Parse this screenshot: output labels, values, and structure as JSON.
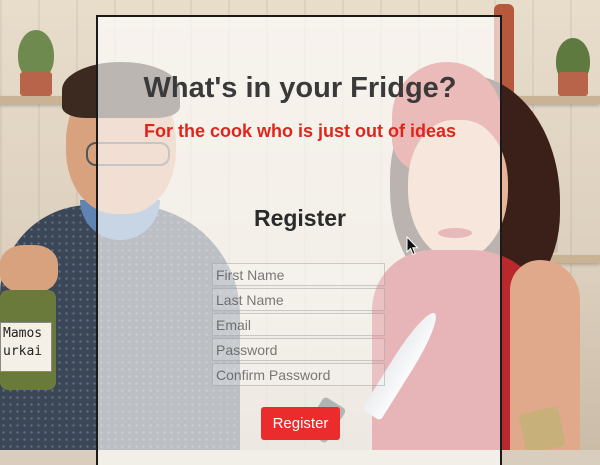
{
  "header": {
    "title": "What's in your Fridge?",
    "subtitle": "For the cook who is just out of ideas"
  },
  "register_form": {
    "heading": "Register",
    "fields": {
      "first_name": {
        "placeholder": "First Name"
      },
      "last_name": {
        "placeholder": "Last Name"
      },
      "email": {
        "placeholder": "Email"
      },
      "password": {
        "placeholder": "Password"
      },
      "confirm_password": {
        "placeholder": "Confirm Password"
      }
    },
    "submit_label": "Register"
  },
  "background": {
    "jar_label": "Mamos\nurkai"
  },
  "colors": {
    "accent_red": "#ea2c2c",
    "subtitle_red": "#e1251b",
    "title_gray": "#3a3a3a"
  },
  "icons": {
    "cursor": "mouse-pointer-icon"
  }
}
